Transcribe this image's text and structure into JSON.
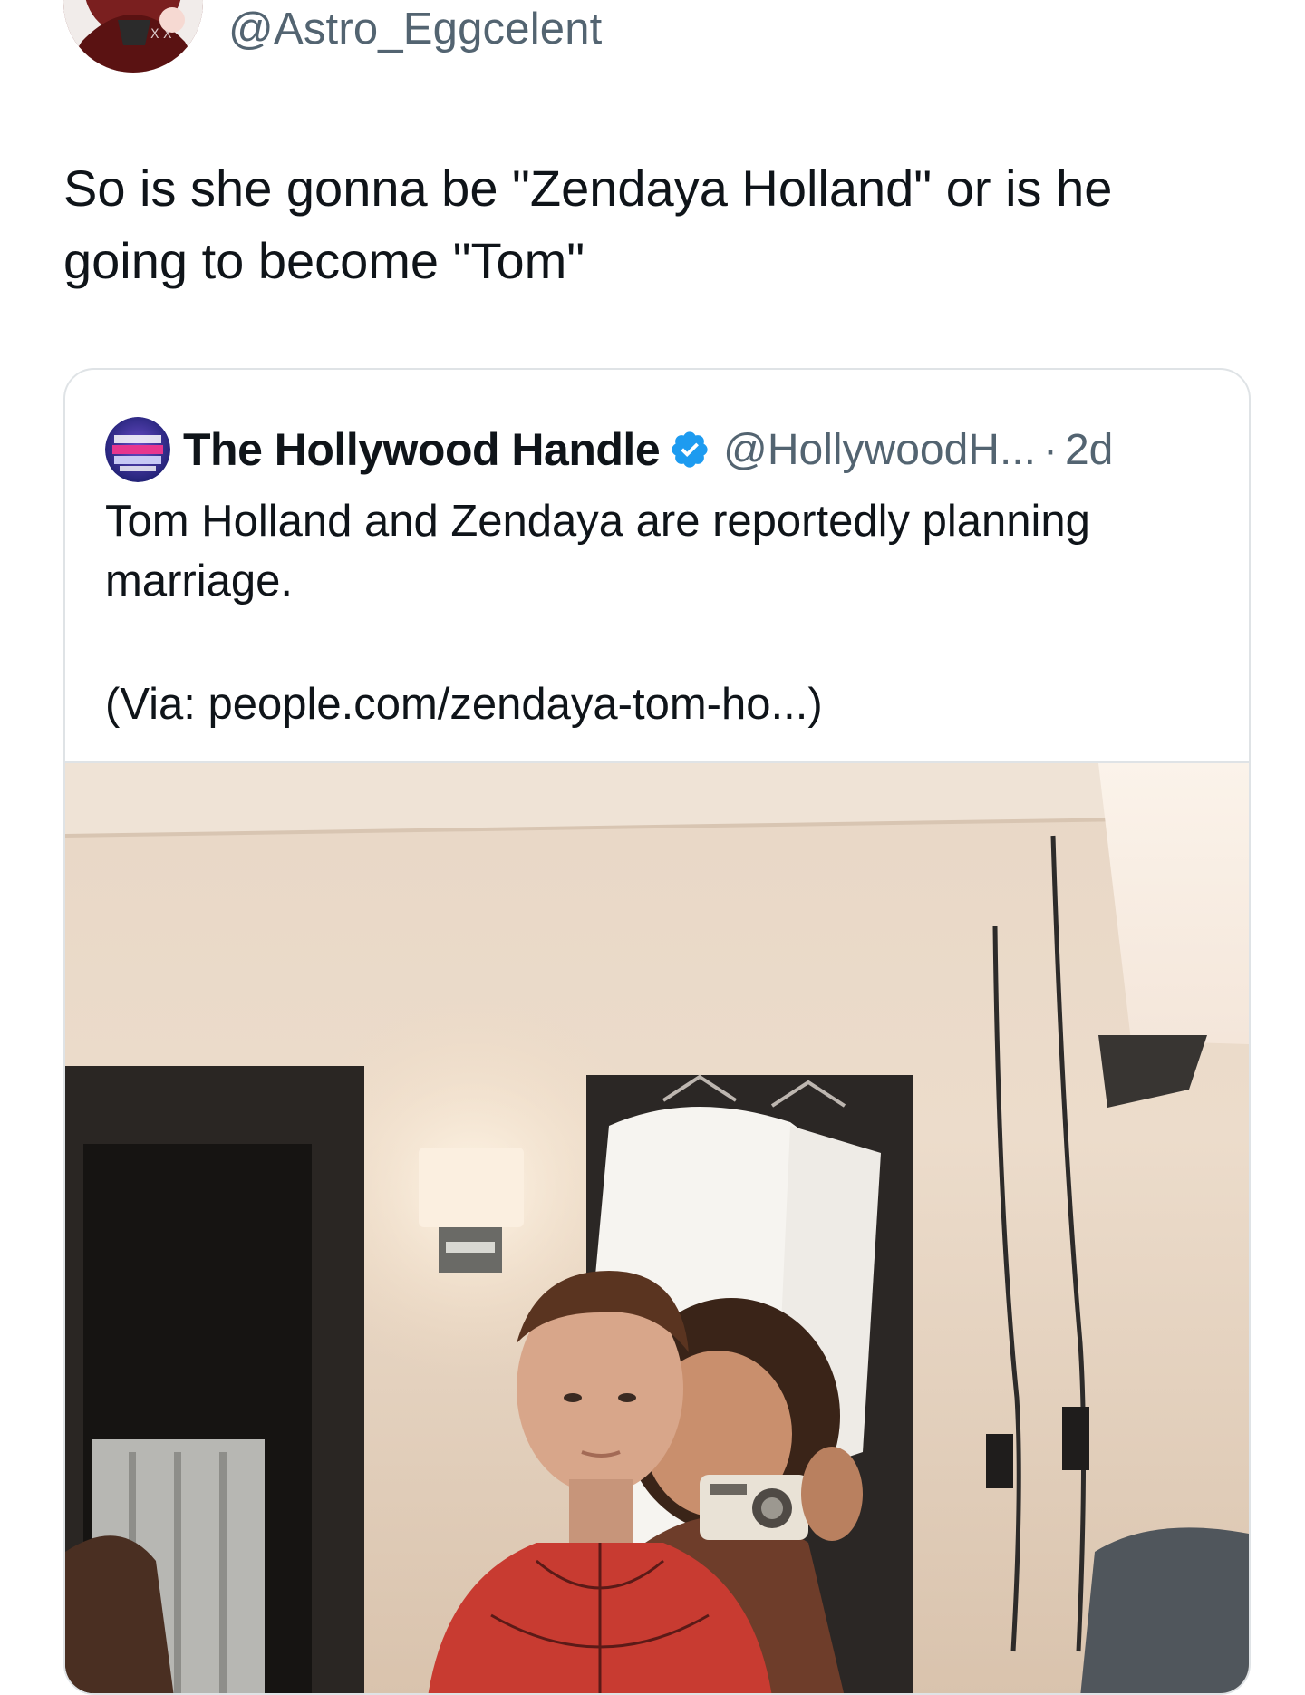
{
  "author": {
    "handle": "@Astro_Eggcelent",
    "avatar_icon": "cartoon-avatar"
  },
  "tweet": {
    "text": "So is she gonna be \"Zendaya Holland\" or is he going to become \"Tom\""
  },
  "quote": {
    "name": "The Hollywood Handle",
    "handle": "@HollywoodH...",
    "separator": "·",
    "time": "2d",
    "verified_icon": "verified-badge-icon",
    "verified_color": "#1d9bf0",
    "body": "Tom Holland and Zendaya are reportedly planning marriage.",
    "via": "(Via: people.com/zendaya-tom-ho...)",
    "avatar_logo_text": "THE HOLLY WOOD HANDLE",
    "media": "photo"
  },
  "colors": {
    "text_primary": "#0f1419",
    "text_secondary": "#536471",
    "border": "#dfe3e6"
  }
}
